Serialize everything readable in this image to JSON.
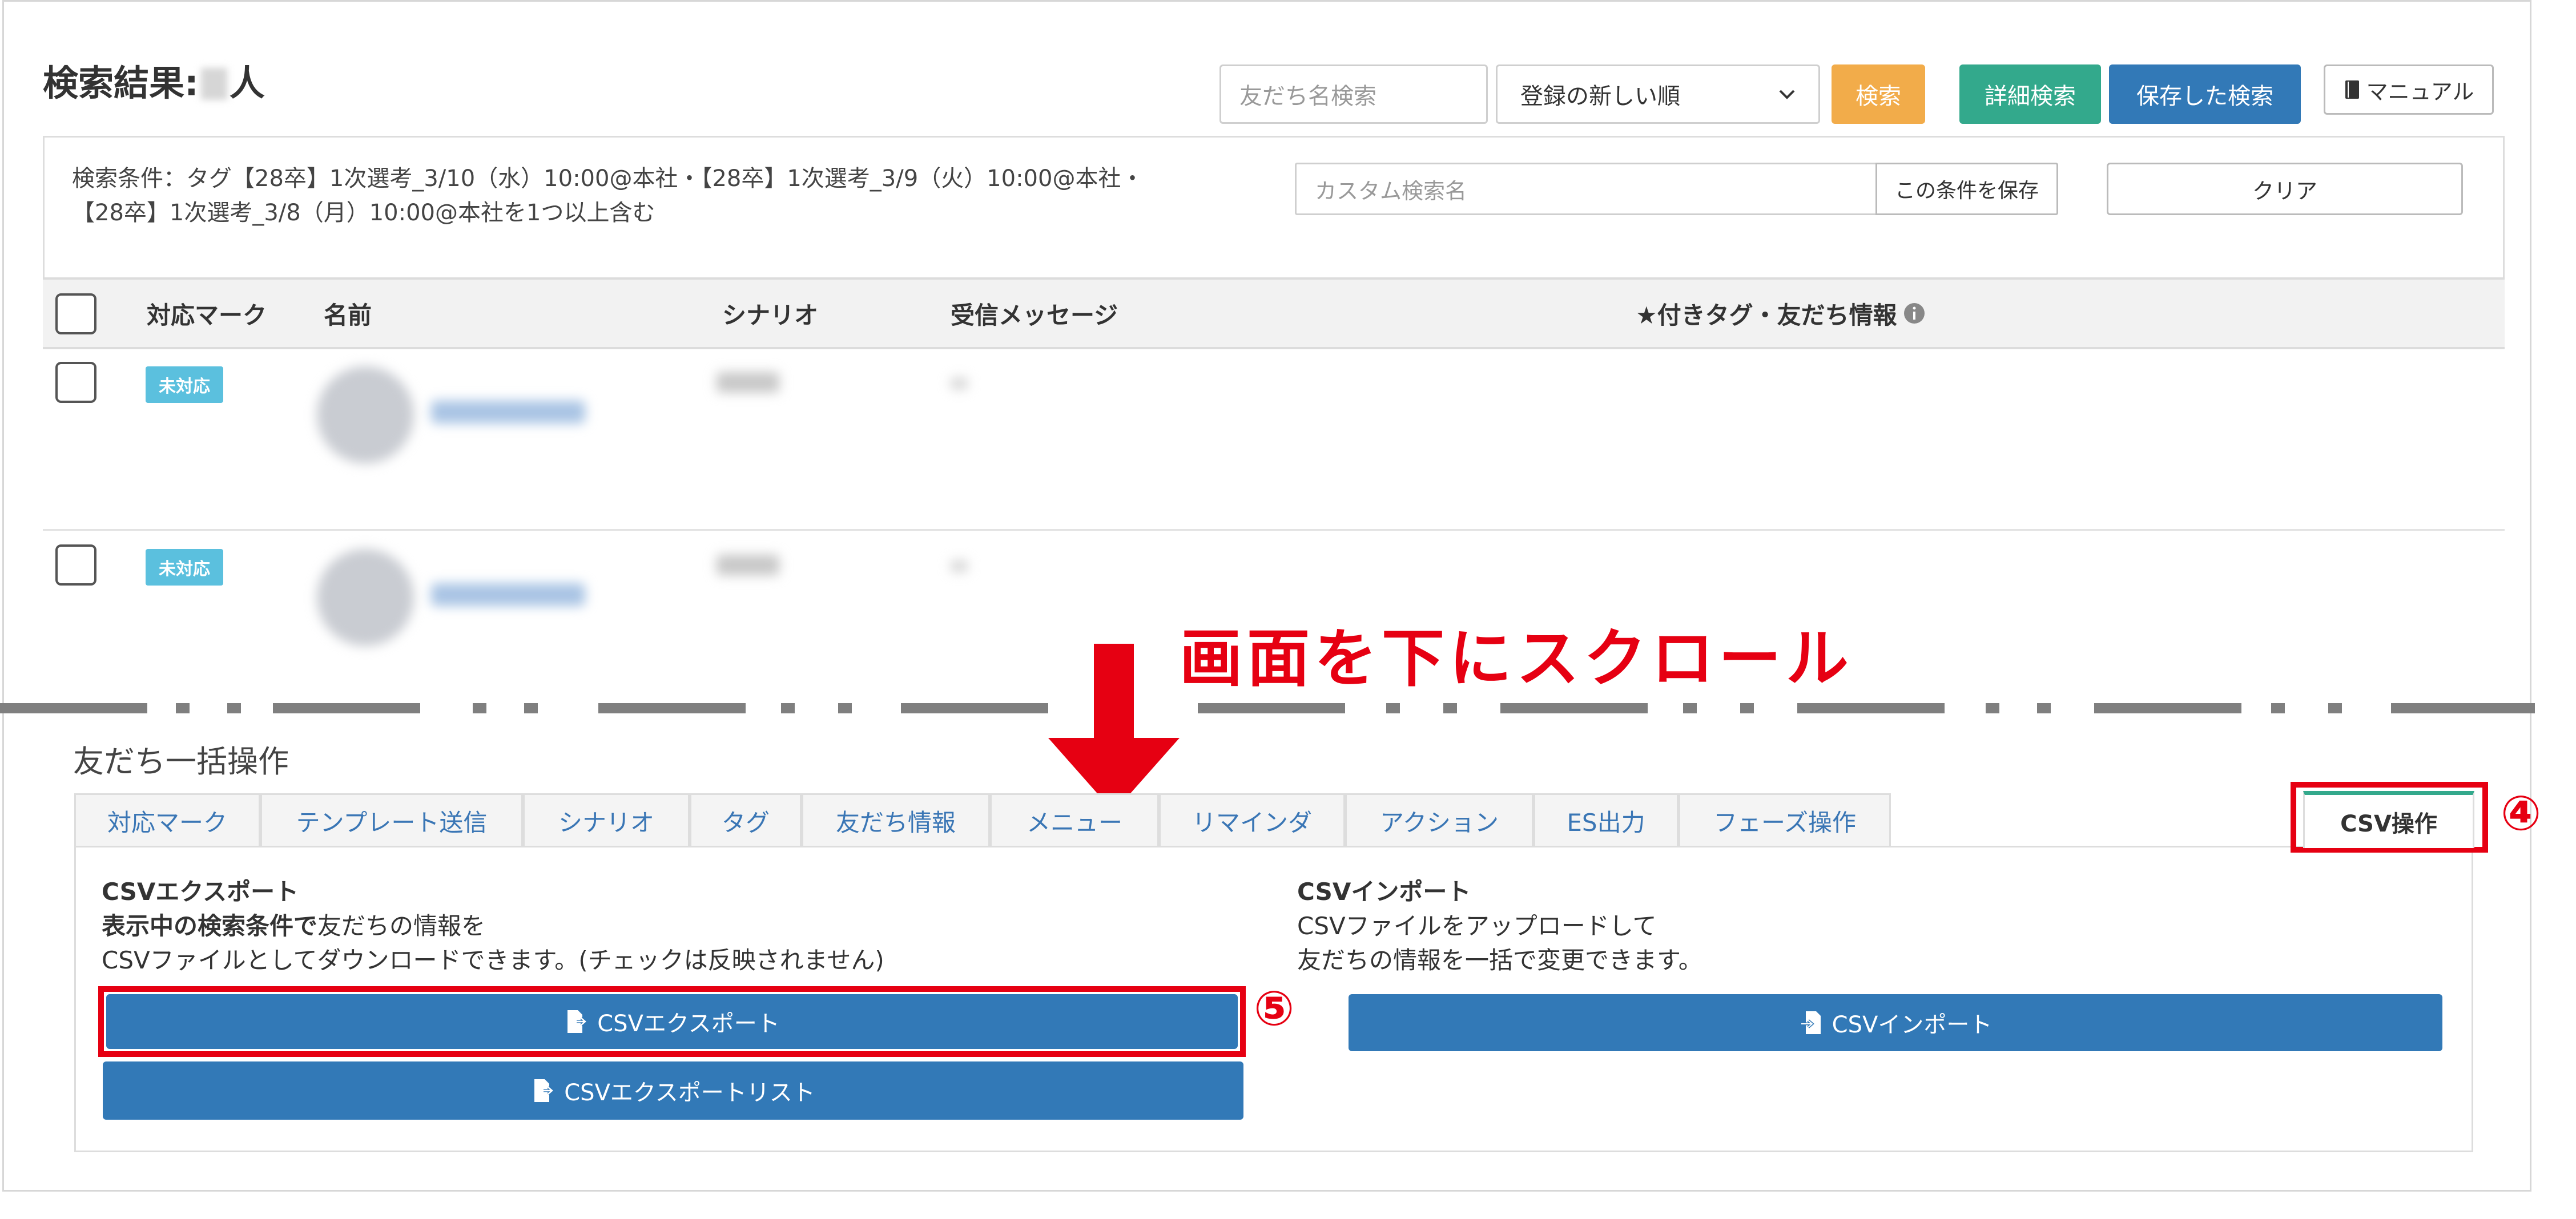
{
  "header": {
    "title_prefix": "検索結果:",
    "title_suffix": "人",
    "friend_search_placeholder": "友だち名検索",
    "sort_selected": "登録の新しい順",
    "search_btn": "検索",
    "detail_search_btn": "詳細検索",
    "saved_search_btn": "保存した検索",
    "manual_btn": "マニュアル"
  },
  "conditions": {
    "line1": "検索条件：タグ【28卒】1次選考_3/10（水）10:00@本社・【28卒】1次選考_3/9（火）10:00@本社・",
    "line2": "【28卒】1次選考_3/8（月）10:00@本社を1つ以上含む",
    "custom_name_placeholder": "カスタム検索名",
    "save_condition_btn": "この条件を保存",
    "clear_btn": "クリア"
  },
  "table": {
    "headers": [
      "対応マーク",
      "名前",
      "シナリオ",
      "受信メッセージ",
      "★付きタグ・友だち情報"
    ],
    "rows": [
      {
        "badge": "未対応"
      },
      {
        "badge": "未対応"
      }
    ]
  },
  "annotation": {
    "scroll_text": "画面を下にスクロール",
    "step4": "④",
    "step5": "⑤"
  },
  "bulk": {
    "heading": "友だち一括操作",
    "tabs": [
      "対応マーク",
      "テンプレート送信",
      "シナリオ",
      "タグ",
      "友だち情報",
      "メニュー",
      "リマインダ",
      "アクション",
      "ES出力",
      "フェーズ操作"
    ],
    "csv_tab": "CSV操作",
    "export_title": "CSVエクスポート",
    "export_desc_bold": "表示中の検索条件で",
    "export_desc_rest": "友だちの情報を",
    "export_desc2": "CSVファイルとしてダウンロードできます。(チェックは反映されません)",
    "export_btn": "CSVエクスポート",
    "export_list_btn": "CSVエクスポートリスト",
    "import_title": "CSVインポート",
    "import_desc1": "CSVファイルをアップロードして",
    "import_desc2": "友だちの情報を一括で変更できます。",
    "import_btn": "CSVインポート"
  },
  "colors": {
    "accent_red": "#e60012",
    "primary_blue": "#3279b7",
    "success_green": "#33a98c",
    "warning_orange": "#f2ac4a",
    "badge_cyan": "#5bc0de"
  }
}
